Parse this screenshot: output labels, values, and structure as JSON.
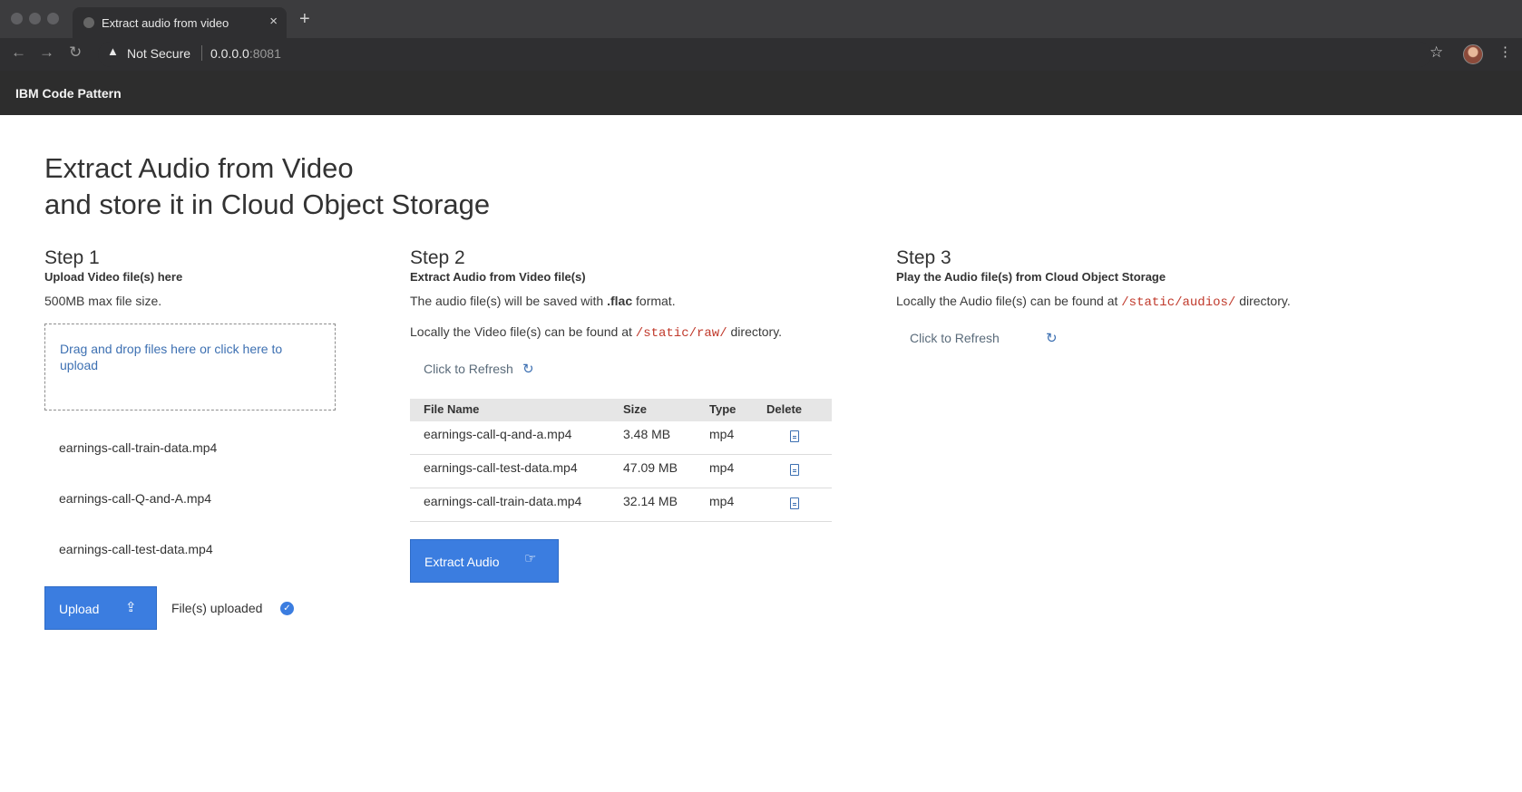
{
  "browser": {
    "tab_title": "Extract audio from video",
    "tab_close": "×",
    "new_tab": "+",
    "nav_back": "←",
    "nav_forward": "→",
    "nav_reload": "↻",
    "security_warning": "▲",
    "security_label": "Not Secure",
    "url_host": "0.0.0.0",
    "url_port": ":8081",
    "bookmark_star": "☆",
    "menu": "⋮"
  },
  "app": {
    "brand": "IBM Code Pattern",
    "title_line1": "Extract Audio from Video",
    "title_line2": "and store it in Cloud Object Storage"
  },
  "step1": {
    "heading": "Step 1",
    "subheading": "Upload Video file(s) here",
    "note": "500MB max file size.",
    "dropzone_text": "Drag and drop files here or click here to upload",
    "files": [
      "earnings-call-train-data.mp4",
      "earnings-call-Q-and-A.mp4",
      "earnings-call-test-data.mp4"
    ],
    "upload_label": "Upload",
    "upload_icon": "⇪",
    "status_label": "File(s) uploaded",
    "status_icon": "✓"
  },
  "step2": {
    "heading": "Step 2",
    "subheading": "Extract Audio from Video file(s)",
    "format_pre": "The audio file(s) will be saved with ",
    "format_ext": ".flac",
    "format_post": " format.",
    "location_pre": "Locally the Video file(s) can be found at ",
    "location_path": "/static/raw/",
    "location_post": " directory.",
    "refresh_label": "Click to Refresh",
    "refresh_icon": "↻",
    "table": {
      "headers": [
        "File Name",
        "Size",
        "Type",
        "Delete"
      ],
      "rows": [
        {
          "name": "earnings-call-q-and-a.mp4",
          "size": "3.48 MB",
          "type": "mp4"
        },
        {
          "name": "earnings-call-test-data.mp4",
          "size": "47.09 MB",
          "type": "mp4"
        },
        {
          "name": "earnings-call-train-data.mp4",
          "size": "32.14 MB",
          "type": "mp4"
        }
      ]
    },
    "extract_label": "Extract Audio"
  },
  "step3": {
    "heading": "Step 3",
    "subheading": "Play the Audio file(s) from Cloud Object Storage",
    "location_pre": "Locally the Audio file(s) can be found at ",
    "location_path": "/static/audios/",
    "location_post": " directory.",
    "refresh_label": "Click to Refresh",
    "refresh_icon": "↻"
  },
  "colors": {
    "primary": "#3b7de0",
    "link": "#3d70b2",
    "code": "#c0392b",
    "appbar": "#2d2d2d"
  }
}
